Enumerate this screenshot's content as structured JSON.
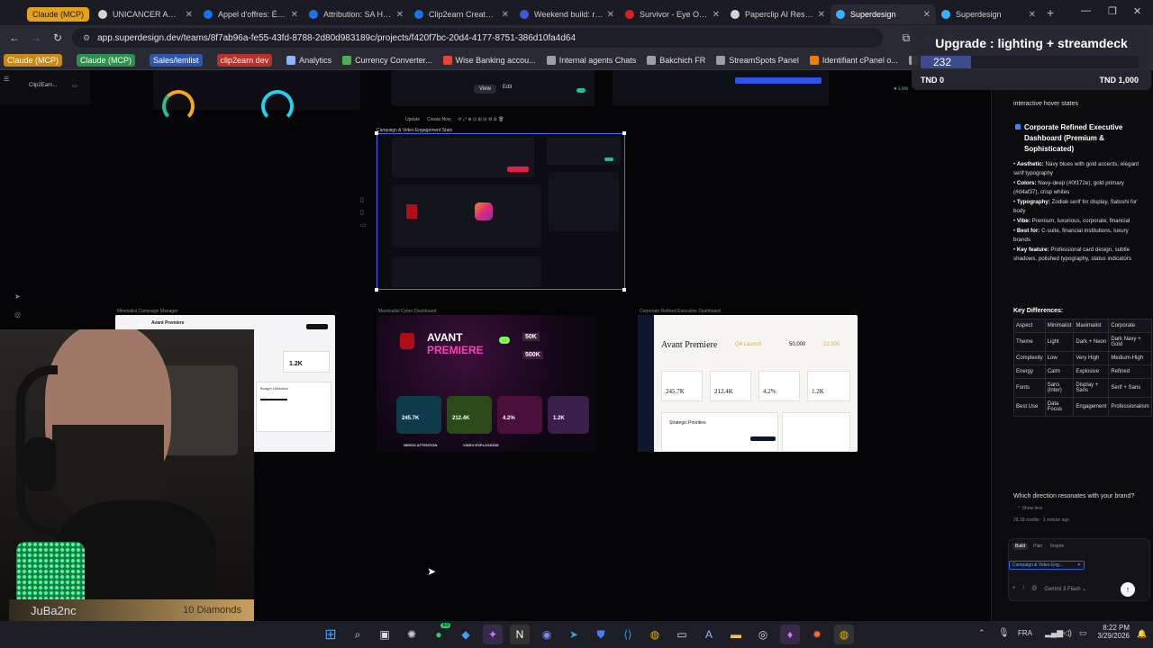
{
  "browser": {
    "group_chip": "Claude (MCP)",
    "tabs": [
      {
        "title": "UNICANCER ACHA",
        "color": "#d4d4d4"
      },
      {
        "title": "Appel d'offres: Écol",
        "color": "#1a73e8"
      },
      {
        "title": "Attribution: SA HLM",
        "color": "#1a73e8"
      },
      {
        "title": "Clip2earn Creator P",
        "color": "#1a73e8"
      },
      {
        "title": "Weekend build: rev",
        "color": "#3b5bdb"
      },
      {
        "title": "Survivor - Eye Of Th",
        "color": "#e02020"
      },
      {
        "title": "Paperclip AI Resear",
        "color": "#d4d4d4"
      },
      {
        "title": "Superdesign",
        "color": "#3ab0ff"
      },
      {
        "title": "Superdesign",
        "color": "#3ab0ff"
      }
    ],
    "active_tab_index": 7,
    "url": "app.superdesign.dev/teams/8f7ab96a-fe55-43fd-8788-2d80d983189c/projects/f420f7bc-20d4-4177-8751-386d10fa4d64",
    "bookmarks": [
      {
        "label": "Claude (MCP)",
        "style": "chip-orange"
      },
      {
        "label": "Claude (MCP)",
        "style": "green-check"
      },
      {
        "label": "Sales/lemlist",
        "style": "chip-blue"
      },
      {
        "label": "clip2earn dev",
        "style": "chip-red"
      },
      {
        "label": "Analytics",
        "style": "grid"
      },
      {
        "label": "Currency Converter...",
        "style": "green"
      },
      {
        "label": "Wise Banking accou...",
        "style": "google"
      },
      {
        "label": "Internal agents Chats",
        "style": "folder"
      },
      {
        "label": "Bakchich FR",
        "style": "folder"
      },
      {
        "label": "StreamSpots Panel",
        "style": "folder"
      },
      {
        "label": "Identifiant cPanel o...",
        "style": "orange"
      },
      {
        "label": "clip2earn",
        "style": "folder"
      }
    ]
  },
  "overlay": {
    "title": "Upgrade : lighting + streamdeck",
    "value": "232",
    "progress_fraction": 0.232,
    "min_label": "TND 0",
    "max_label": "TND 1,000"
  },
  "canvas": {
    "top_strip_label": "Clip2Earn...",
    "selected_frame": {
      "label": "Campaign & Video Engagement Stats",
      "toolbar": [
        "Update",
        "Create Now"
      ],
      "view": "View",
      "edit": "Edit"
    },
    "frames": [
      {
        "label": "Minimalist Campaign Manager",
        "title": "Avant Premiere",
        "card1": "1.2K",
        "card2": "Budget Utilization"
      },
      {
        "label": "Maximalist Cyber-Dashboard",
        "hero1": "AVANT",
        "hero2": "PREMIERE",
        "badge1": "50K",
        "badge2": "500K",
        "stats": [
          "245.7K",
          "212.4K",
          "4.2%",
          "1.2K"
        ],
        "footer1": "NEEDS ATTENTION",
        "footer2": "VIDEO EXPLOSIONS"
      },
      {
        "label": "Corporate Refined Executive Dashboard",
        "title": "Avant Premiere",
        "subtitle": "Q4 Launch",
        "kpi1": "50,000",
        "kpi2": "22,500",
        "stats": [
          "245.7K",
          "212.4K",
          "4.2%",
          "1.2K"
        ],
        "section": "Strategic Priorities"
      }
    ]
  },
  "chat": {
    "intro": "interactive hover states",
    "section_title": "Corporate Refined Executive Dashboard (Premium & Sophisticated)",
    "bullets": [
      {
        "k": "Aesthetic:",
        "v": "Navy blues with gold accents, elegant serif typography"
      },
      {
        "k": "Colors:",
        "v": "Navy-deep (#0f172e), gold primary (#d4af37), crisp whites"
      },
      {
        "k": "Typography:",
        "v": "Zodiak serif for display, Satoshi for body"
      },
      {
        "k": "Vibe:",
        "v": "Premium, luxurious, corporate, financial"
      },
      {
        "k": "Best for:",
        "v": "C-suite, financial institutions, luxury brands"
      },
      {
        "k": "Key feature:",
        "v": "Professional card design, subtle shadows, polished typography, status indicators"
      }
    ],
    "key_diff": "Key Differences:",
    "table": {
      "headers": [
        "Aspect",
        "Minimalist",
        "Maximalist",
        "Corporate"
      ],
      "rows": [
        [
          "Theme",
          "Light",
          "Dark + Neon",
          "Dark Navy + Gold"
        ],
        [
          "Complexity",
          "Low",
          "Very High",
          "Medium-High"
        ],
        [
          "Energy",
          "Calm",
          "Explosive",
          "Refined"
        ],
        [
          "Fonts",
          "Sans (Inter)",
          "Display + Sans",
          "Serif + Sans"
        ],
        [
          "Best Use",
          "Data Focus",
          "Engagement",
          "Professionalism"
        ]
      ]
    },
    "question": "Which direction resonates with your brand?",
    "show_less": "Show less",
    "meta": "26.18 credits · 1 minute ago",
    "modes": [
      "Build",
      "Plan",
      "Inspire"
    ],
    "context_chip": "Campaign & Video Eng...",
    "model": "Gemini 3 Flash"
  },
  "stream": {
    "name": "JuBa2nc",
    "diamonds": "10 Diamonds"
  },
  "taskbar": {
    "lang": "FRA",
    "time": "8:22 PM",
    "date": "3/29/2026",
    "whatsapp_badge": "63"
  }
}
